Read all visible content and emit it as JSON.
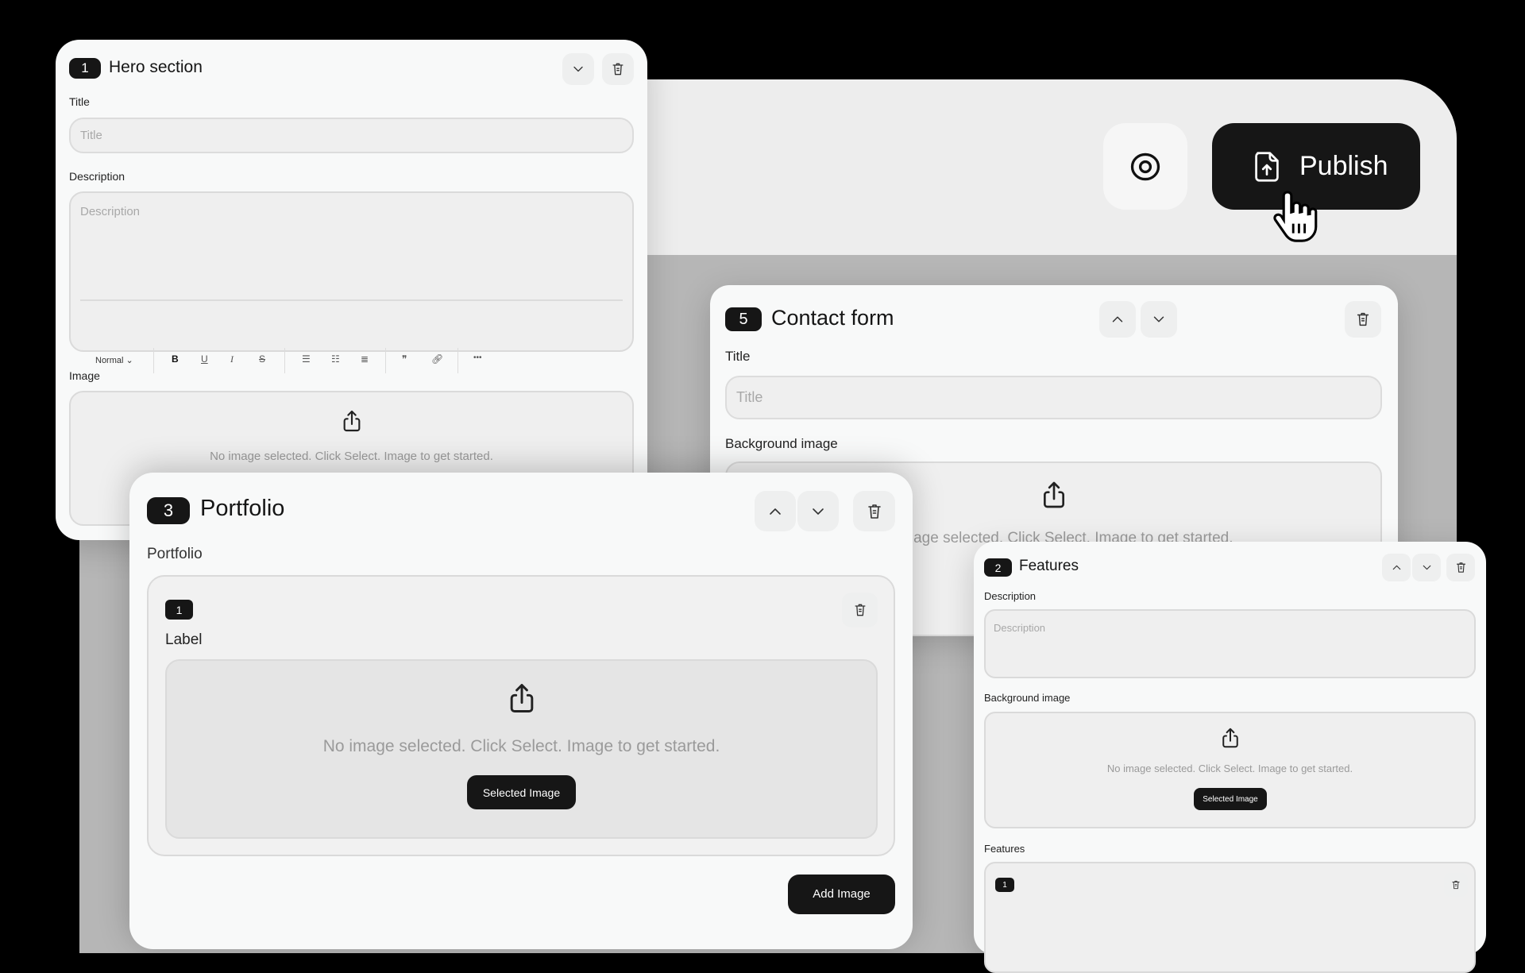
{
  "toolbar": {
    "preview_icon": "eye-icon",
    "publish_label": "Publish",
    "publish_icon": "file-upload-icon"
  },
  "hero": {
    "number": "1",
    "title": "Hero section",
    "title_label": "Title",
    "title_placeholder": "Title",
    "description_label": "Description",
    "description_placeholder": "Description",
    "format_select": "Normal",
    "format_buttons": [
      "bold",
      "underline",
      "italic",
      "strikethrough",
      "bullet-list",
      "numbered-list",
      "indent",
      "quote",
      "link",
      "more"
    ],
    "image_label": "Image",
    "empty_message": "No image selected. Click Select. Image to get started."
  },
  "contact": {
    "number": "5",
    "title": "Contact form",
    "title_label": "Title",
    "title_placeholder": "Title",
    "bg_label": "Background image",
    "empty_message": "No image selected. Click Select. Image to get started."
  },
  "portfolio": {
    "number": "3",
    "title": "Portfolio",
    "section_label": "Portfolio",
    "item": {
      "number": "1",
      "label": "Label",
      "empty_message": "No image selected. Click Select. Image to get started.",
      "select_button": "Selected Image"
    },
    "add_button": "Add Image"
  },
  "features": {
    "number": "2",
    "title": "Features",
    "description_label": "Description",
    "description_placeholder": "Description",
    "bg_label": "Background image",
    "empty_message": "No image selected. Click Select. Image to get started.",
    "select_button": "Selected Image",
    "features_label": "Features",
    "item_number": "1"
  }
}
